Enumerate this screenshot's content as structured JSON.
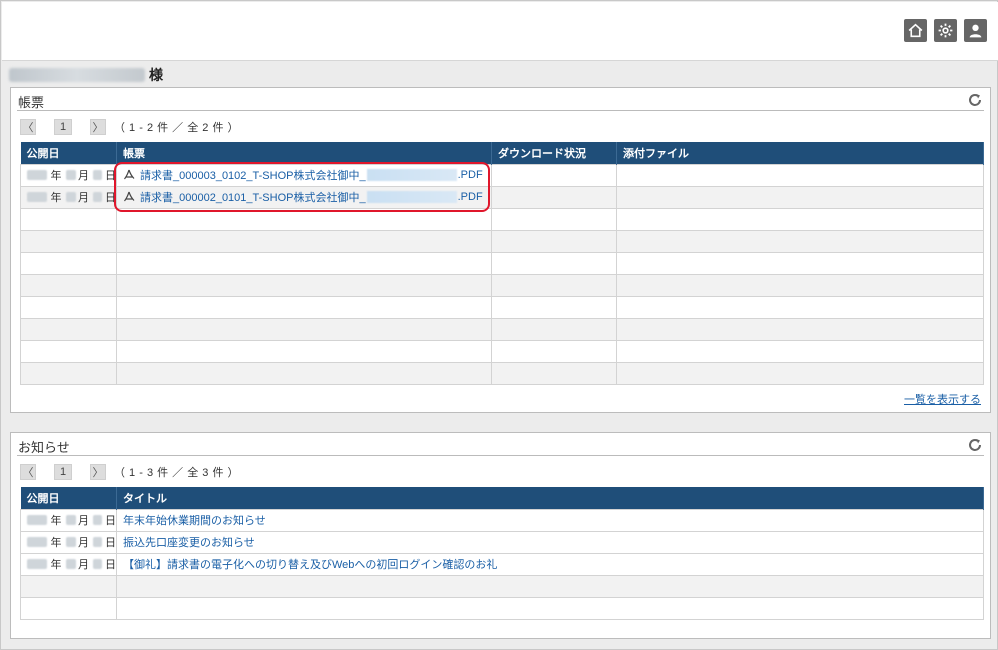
{
  "header": {
    "icons": [
      {
        "name": "home-icon"
      },
      {
        "name": "gear-icon"
      },
      {
        "name": "user-icon"
      }
    ]
  },
  "customer": {
    "suffix": "様"
  },
  "documents_panel": {
    "title": "帳票",
    "pager": {
      "prev": "〈",
      "page": "1",
      "next": "〉",
      "count": "（ 1 - 2 件 ／ 全 2 件 ）"
    },
    "columns": [
      "公開日",
      "帳票",
      "ダウンロード状況",
      "添付ファイル"
    ],
    "rows": [
      {
        "year": "年",
        "month": "月",
        "day": "日",
        "name_prefix": "請求書_000003_0102_T-SHOP株式会社御中_",
        "name_suffix": ".PDF"
      },
      {
        "year": "年",
        "month": "月",
        "day": "日",
        "name_prefix": "請求書_000002_0101_T-SHOP株式会社御中_",
        "name_suffix": ".PDF"
      }
    ],
    "more_link": "一覧を表示する"
  },
  "notices_panel": {
    "title": "お知らせ",
    "pager": {
      "prev": "〈",
      "page": "1",
      "next": "〉",
      "count": "（ 1 - 3 件 ／ 全 3 件 ）"
    },
    "columns": [
      "公開日",
      "タイトル"
    ],
    "rows": [
      {
        "year": "年",
        "month": "月",
        "day": "日",
        "title": "年末年始休業期間のお知らせ"
      },
      {
        "year": "年",
        "month": "月",
        "day": "日",
        "title": "振込先口座変更のお知らせ"
      },
      {
        "year": "年",
        "month": "月",
        "day": "日",
        "title": "【御礼】請求書の電子化への切り替え及びWebへの初回ログイン確認のお礼"
      }
    ]
  },
  "colors": {
    "table_header": "#1f4e79",
    "link": "#1a5fa6",
    "highlight": "#e0162b"
  }
}
